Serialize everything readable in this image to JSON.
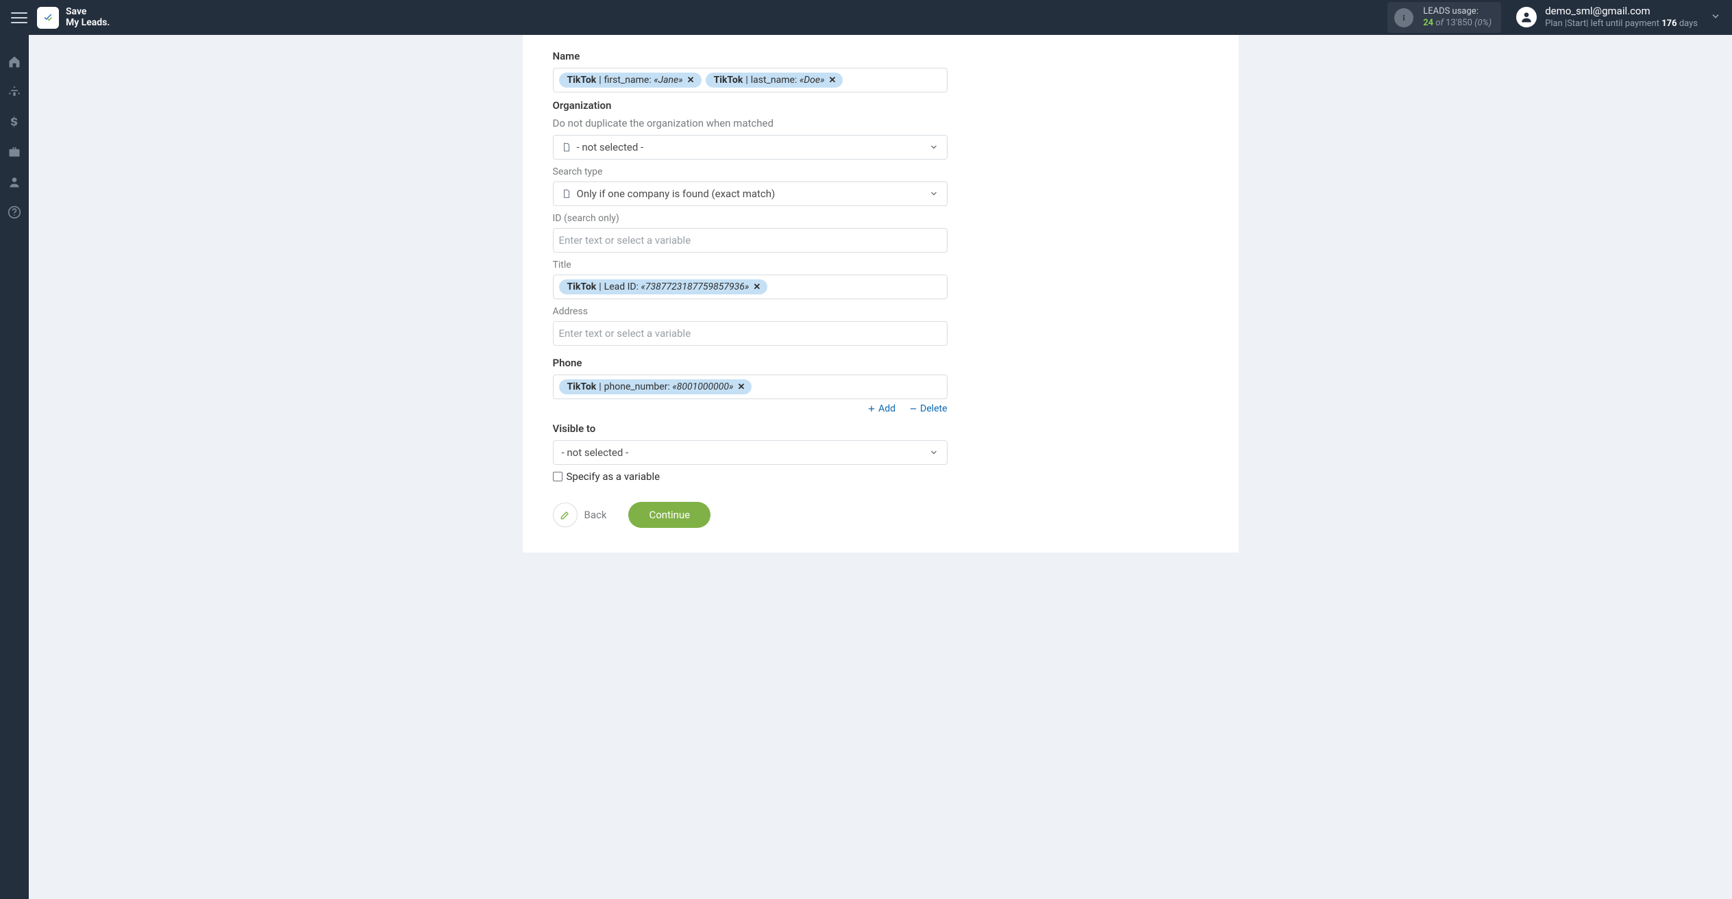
{
  "header": {
    "brand": "Save\nMy Leads.",
    "leads": {
      "label": "LEADS usage:",
      "used": "24",
      "of": "of",
      "total": "13'850",
      "pct": "(0%)"
    },
    "user": {
      "email": "demo_sml@gmail.com",
      "plan_prefix": "Plan |Start| left until payment ",
      "days": "176",
      "days_suffix": " days"
    }
  },
  "fields": {
    "name": {
      "label": "Name",
      "tags": [
        {
          "src": "TikTok",
          "key": "first_name:",
          "val": "«Jane»"
        },
        {
          "src": "TikTok",
          "key": "last_name:",
          "val": "«Doe»"
        }
      ]
    },
    "organization": {
      "label": "Organization",
      "sublabel": "Do not duplicate the organization when matched",
      "selected": "- not selected -"
    },
    "search_type": {
      "label": "Search type",
      "selected": "Only if one company is found (exact match)"
    },
    "id_search": {
      "label": "ID (search only)",
      "placeholder": "Enter text or select a variable"
    },
    "title": {
      "label": "Title",
      "tag": {
        "src": "TikTok",
        "key": "Lead ID:",
        "val": "«7387723187759857936»"
      }
    },
    "address": {
      "label": "Address",
      "placeholder": "Enter text or select a variable"
    },
    "phone": {
      "label": "Phone",
      "tag": {
        "src": "TikTok",
        "key": "phone_number:",
        "val": "«8001000000»"
      },
      "add": "Add",
      "delete": "Delete"
    },
    "visible_to": {
      "label": "Visible to",
      "selected": "- not selected -",
      "checkbox": "Specify as a variable"
    }
  },
  "buttons": {
    "back": "Back",
    "continue": "Continue"
  }
}
